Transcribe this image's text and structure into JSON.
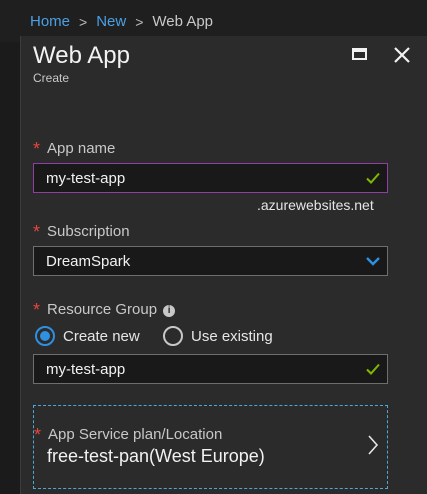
{
  "breadcrumb": {
    "items": [
      "Home",
      "New",
      "Web App"
    ],
    "separator": ">"
  },
  "blade": {
    "title": "Web App",
    "subtitle": "Create"
  },
  "form": {
    "required_mark": "*",
    "app_name": {
      "label": "App name",
      "value": "my-test-app",
      "suffix": ".azurewebsites.net"
    },
    "subscription": {
      "label": "Subscription",
      "value": "DreamSpark"
    },
    "resource_group": {
      "label": "Resource Group",
      "info_glyph": "i",
      "options": [
        "Create new",
        "Use existing"
      ],
      "selected": "Create new",
      "value": "my-test-app"
    },
    "app_service_plan": {
      "label": "App Service plan/Location",
      "value": "free-test-pan(West Europe)"
    }
  },
  "colors": {
    "background": "#1b1b1b",
    "blade": "#2b2b2b",
    "link": "#4aa0e6",
    "required": "#e8453c",
    "valid_check": "#7fba00",
    "focus_border": "#8f3fa1",
    "radio_selected": "#2f8fe0",
    "dashed_border": "#4aa9d9"
  },
  "icons": [
    "maximize-icon",
    "close-icon",
    "checkmark-icon",
    "chevron-down-icon",
    "info-icon",
    "chevron-right-icon"
  ]
}
